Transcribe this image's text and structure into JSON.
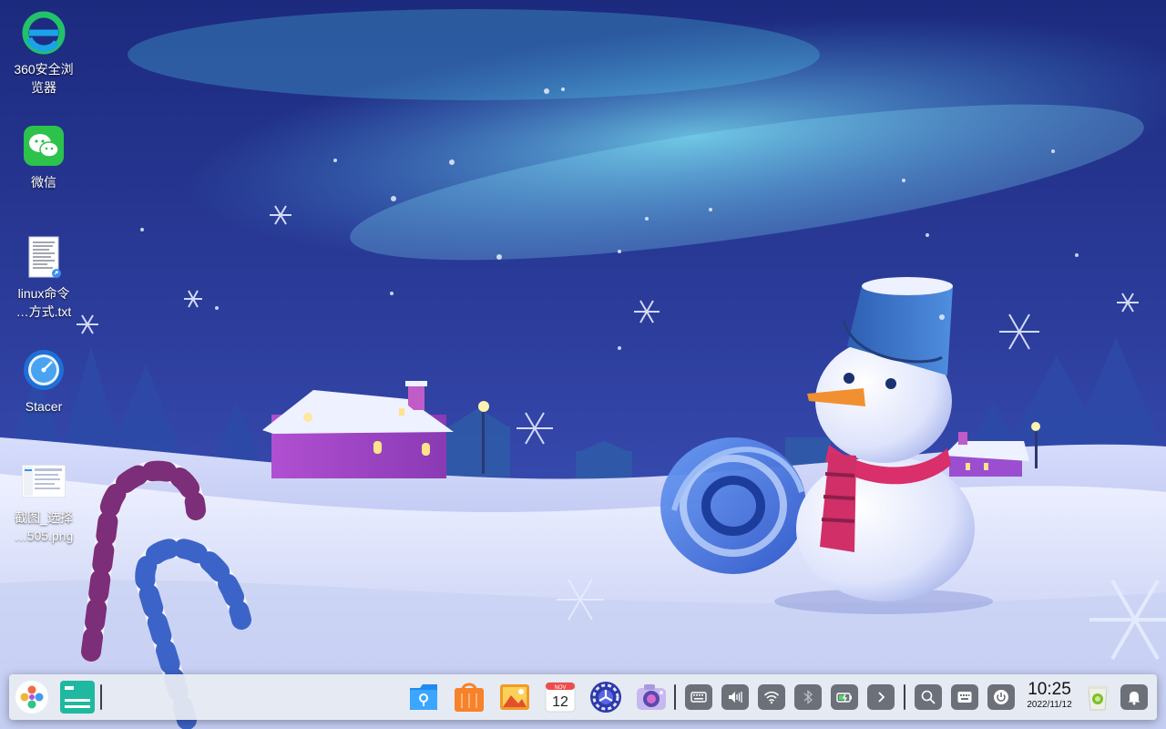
{
  "desktop": {
    "icons": [
      {
        "name": "360-browser",
        "label_line1": "360安全浏",
        "label_line2": "览器",
        "icon": "360-browser-icon"
      },
      {
        "name": "wechat",
        "label_line1": "微信",
        "label_line2": "",
        "icon": "wechat-icon"
      },
      {
        "name": "linux-txt",
        "label_line1": "linux命令",
        "label_line2": "…方式.txt",
        "icon": "text-file-icon"
      },
      {
        "name": "stacer",
        "label_line1": "Stacer",
        "label_line2": "",
        "icon": "stacer-icon"
      },
      {
        "name": "screenshot-png",
        "label_line1": "截图_选择",
        "label_line2": "…505.png",
        "icon": "image-file-icon"
      }
    ]
  },
  "taskbar": {
    "start_icon": "start-menu-icon",
    "pinned_apps": [
      {
        "name": "file-manager",
        "icon": "file-manager-icon"
      },
      {
        "name": "app-store",
        "icon": "app-store-icon"
      },
      {
        "name": "image-viewer",
        "icon": "image-viewer-icon"
      },
      {
        "name": "calendar",
        "icon": "calendar-icon",
        "month": "NOV",
        "day": "12"
      },
      {
        "name": "settings",
        "icon": "settings-icon"
      },
      {
        "name": "camera",
        "icon": "camera-icon"
      }
    ],
    "tray": [
      "keyboard-icon",
      "volume-icon",
      "wifi-icon",
      "bluetooth-icon",
      "battery-icon",
      "chevron-right-icon"
    ],
    "clock": {
      "time": "10:25",
      "date": "2022/11/12"
    }
  },
  "colors": {
    "accent": "#1e8cf0",
    "taskbar_bg": "#e8ecf2",
    "tray_button": "#6c7079"
  }
}
